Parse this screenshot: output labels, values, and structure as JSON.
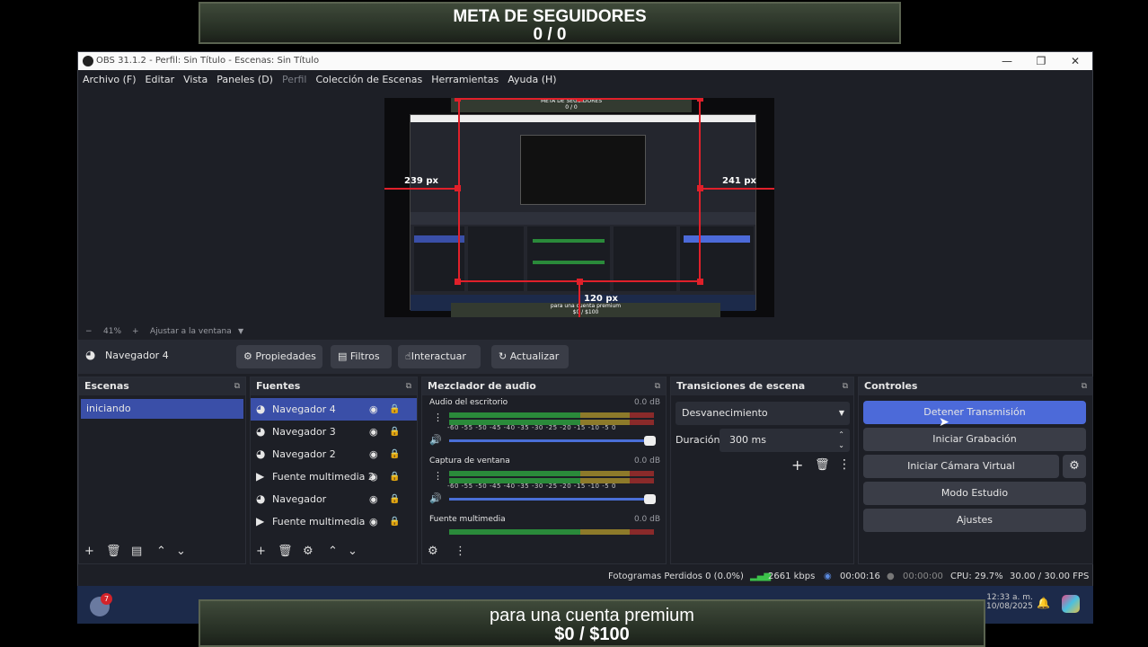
{
  "banner_top": {
    "title": "META DE SEGUIDORES",
    "count": "0 / 0"
  },
  "banner_bottom": {
    "title": "para una cuenta premium",
    "amount": "$0 / $100"
  },
  "window": {
    "title": "OBS 31.1.2 - Perfil: Sin Título - Escenas: Sin Título"
  },
  "menu": [
    "Archivo (F)",
    "Editar",
    "Vista",
    "Paneles (D)",
    "Perfil",
    "Colección de Escenas",
    "Herramientas",
    "Ayuda (H)"
  ],
  "preview": {
    "inner_banner_title": "META DE SEGUIDORES",
    "inner_banner_count": "0 / 0",
    "left_px": "239 px",
    "right_px": "241 px",
    "bottom_px": "120 px",
    "inner_bottom_title": "para una cuenta premium",
    "inner_bottom_amount": "$0 / $100"
  },
  "zoom": {
    "minus": "−",
    "value": "41%",
    "plus": "+",
    "fit": "Ajustar a la ventana"
  },
  "source_toolbar": {
    "selected": "Navegador 4",
    "properties": "Propiedades",
    "filters": "Filtros",
    "interact": "Interactuar",
    "refresh": "Actualizar"
  },
  "docks": {
    "scenes": {
      "title": "Escenas",
      "items": [
        "iniciando"
      ]
    },
    "sources": {
      "title": "Fuentes",
      "items": [
        {
          "name": "Navegador 4",
          "icon": "globe-icon"
        },
        {
          "name": "Navegador 3",
          "icon": "globe-icon"
        },
        {
          "name": "Navegador 2",
          "icon": "globe-icon"
        },
        {
          "name": "Fuente multimedia 2",
          "icon": "play-icon"
        },
        {
          "name": "Navegador",
          "icon": "globe-icon"
        },
        {
          "name": "Fuente multimedia",
          "icon": "play-icon"
        }
      ]
    },
    "mixer": {
      "title": "Mezclador de audio",
      "channels": [
        {
          "name": "Audio del escritorio",
          "db": "0.0 dB"
        },
        {
          "name": "Captura de ventana",
          "db": "0.0 dB"
        },
        {
          "name": "Fuente multimedia",
          "db": "0.0 dB"
        }
      ],
      "ticks": "-60 -55 -50 -45 -40 -35 -30 -25 -20 -15 -10 -5 0"
    },
    "transitions": {
      "title": "Transiciones de escena",
      "selected": "Desvanecimiento",
      "duration_label": "Duración",
      "duration_value": "300 ms"
    },
    "controls": {
      "title": "Controles",
      "stop_stream": "Detener Transmisión",
      "start_recording": "Iniciar Grabación",
      "virtual_cam": "Iniciar Cámara Virtual",
      "studio_mode": "Modo Estudio",
      "settings": "Ajustes"
    }
  },
  "status": {
    "dropped": "Fotogramas Perdidos 0 (0.0%)",
    "bitrate": "2661 kbps",
    "stream_time": "00:00:16",
    "rec_time": "00:00:00",
    "cpu": "CPU: 29.7%",
    "fps": "30.00 / 30.00 FPS"
  },
  "taskbar": {
    "badge": "7",
    "time": "12:33 a. m.",
    "date": "10/08/2025"
  },
  "colors": {
    "accent": "#4c6ad9",
    "dock_bg": "#1d1f26",
    "selected_row": "#3a4fa8"
  }
}
